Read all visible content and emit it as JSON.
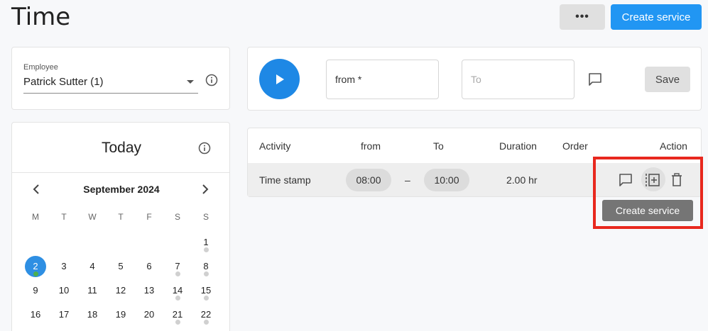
{
  "page": {
    "title": "Time"
  },
  "header": {
    "more_label": "•••",
    "create_service_label": "Create service"
  },
  "employee": {
    "label": "Employee",
    "value": "Patrick Sutter (1)"
  },
  "timer": {
    "from_placeholder": "from *",
    "to_placeholder": "To",
    "save_label": "Save"
  },
  "table": {
    "headers": {
      "activity": "Activity",
      "from": "from",
      "to": "To",
      "duration": "Duration",
      "order": "Order",
      "action": "Action"
    },
    "rows": [
      {
        "activity": "Time stamp",
        "from": "08:00",
        "dash": "–",
        "to": "10:00",
        "duration": "2.00 hr",
        "order": ""
      }
    ]
  },
  "tooltip": {
    "text": "Create service"
  },
  "calendar": {
    "title": "Today",
    "month": "September 2024",
    "weekdays": [
      "M",
      "T",
      "W",
      "T",
      "F",
      "S",
      "S"
    ],
    "weeks": [
      [
        "",
        "",
        "",
        "",
        "",
        "",
        "1"
      ],
      [
        "2",
        "3",
        "4",
        "5",
        "6",
        "7",
        "8"
      ],
      [
        "9",
        "10",
        "11",
        "12",
        "13",
        "14",
        "15"
      ],
      [
        "16",
        "17",
        "18",
        "19",
        "20",
        "21",
        "22"
      ]
    ],
    "today": "2"
  },
  "colors": {
    "accent": "#2196f3",
    "highlight": "#e8281e",
    "tooltip": "#757575"
  }
}
